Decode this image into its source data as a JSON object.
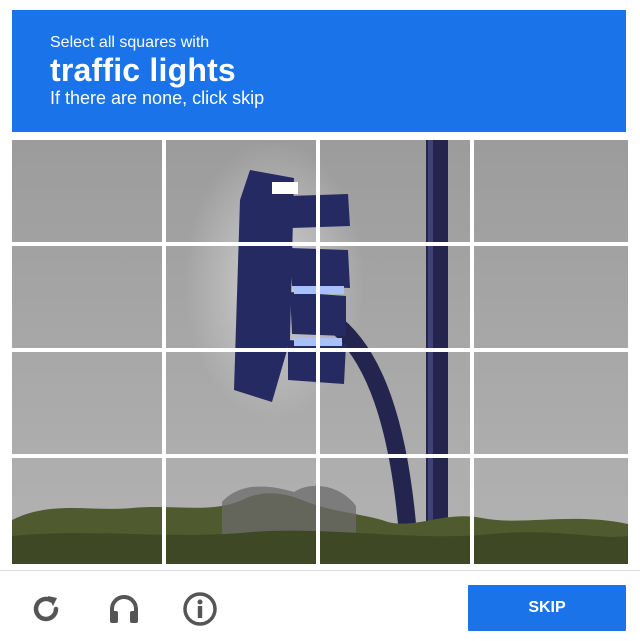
{
  "header": {
    "instruction": "Select all squares with",
    "target_object": "traffic lights",
    "hint": "If there are none, click skip"
  },
  "grid": {
    "rows": 4,
    "cols": 4,
    "selected_tiles": []
  },
  "footer": {
    "reload_icon": "reload-icon",
    "audio_icon": "headphones-icon",
    "info_icon": "info-icon",
    "skip_label": "SKIP"
  },
  "colors": {
    "accent": "#1a73e8",
    "sky": "#a6a6a6",
    "signal": "#2a2f6e",
    "lens_glow": "#9fb8ff",
    "foliage": "#4f5a2f"
  }
}
